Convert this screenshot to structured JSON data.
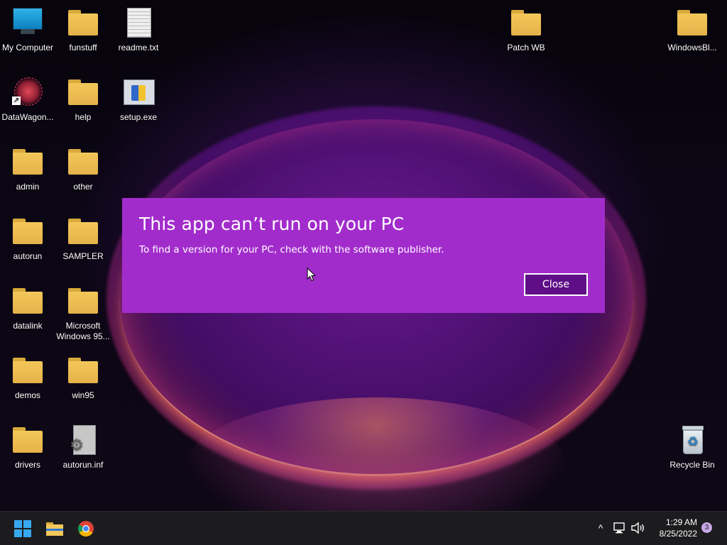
{
  "desktop_icons": {
    "my_computer": "My Computer",
    "funstuff": "funstuff",
    "readme": "readme.txt",
    "patch_wb": "Patch WB",
    "windowsbl": "WindowsBl...",
    "datawagon": "DataWagon...",
    "help": "help",
    "setup": "setup.exe",
    "admin": "admin",
    "other": "other",
    "autorun": "autorun",
    "sampler": "SAMPLER",
    "datalink": "datalink",
    "win95_folder": "Microsoft Windows 95...",
    "demos": "demos",
    "win95": "win95",
    "drivers": "drivers",
    "autorun_inf": "autorun.inf",
    "recycle_bin": "Recycle Bin"
  },
  "dialog": {
    "title": "This app can’t run on your PC",
    "message": "To find a version for your PC, check with the software publisher.",
    "close_label": "Close",
    "background_color": "#a22ccb",
    "button_color": "#5f0e87"
  },
  "taskbar": {
    "start_icon": "windows-start-icon",
    "apps": [
      "file-explorer-icon",
      "chrome-icon"
    ],
    "tray": {
      "chevron": "^",
      "time": "1:29 AM",
      "date": "8/25/2022",
      "notification_count": "3"
    }
  }
}
